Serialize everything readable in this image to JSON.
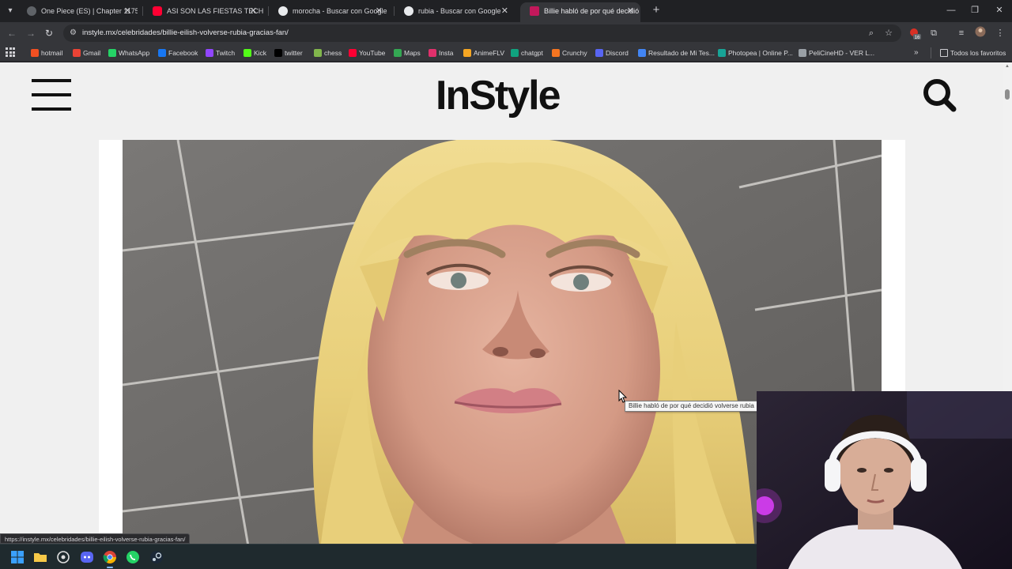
{
  "browser": {
    "tabs": [
      {
        "title": "One Piece (ES) | Chapter 1175",
        "favicon": "onepiece-icon",
        "color": "#9aa0a6",
        "active": false
      },
      {
        "title": "ASI SON LAS FIESTAS TECHNO",
        "favicon": "youtube-icon",
        "color": "#ff0033",
        "active": false
      },
      {
        "title": "morocha - Buscar con Google",
        "favicon": "google-icon",
        "color": "#e8eaed",
        "active": false
      },
      {
        "title": "rubia - Buscar con Google",
        "favicon": "google-icon",
        "color": "#e8eaed",
        "active": false
      },
      {
        "title": "Billie habló de por qué decidió",
        "favicon": "instyle-icon",
        "color": "#c2185b",
        "active": true
      }
    ],
    "new_tab_label": "+",
    "url": "instyle.mx/celebridades/billie-eilish-volverse-rubia-gracias-fan/",
    "bookmarks": [
      {
        "label": "hotmail",
        "icon": "microsoft-icon",
        "color": "#f25022"
      },
      {
        "label": "Gmail",
        "icon": "gmail-icon",
        "color": "#ea4335"
      },
      {
        "label": "WhatsApp",
        "icon": "whatsapp-icon",
        "color": "#25d366"
      },
      {
        "label": "Facebook",
        "icon": "facebook-icon",
        "color": "#1877f2"
      },
      {
        "label": "Twitch",
        "icon": "twitch-icon",
        "color": "#9146ff"
      },
      {
        "label": "Kick",
        "icon": "kick-icon",
        "color": "#53fc18"
      },
      {
        "label": "twitter",
        "icon": "x-icon",
        "color": "#000000"
      },
      {
        "label": "chess",
        "icon": "chess-icon",
        "color": "#81b64c"
      },
      {
        "label": "YouTube",
        "icon": "youtube-icon",
        "color": "#ff0033"
      },
      {
        "label": "Maps",
        "icon": "maps-icon",
        "color": "#34a853"
      },
      {
        "label": "Insta",
        "icon": "instagram-icon",
        "color": "#e1306c"
      },
      {
        "label": "AnimeFLV",
        "icon": "animeflv-icon",
        "color": "#f5a623"
      },
      {
        "label": "chatgpt",
        "icon": "chatgpt-icon",
        "color": "#10a37f"
      },
      {
        "label": "Crunchy",
        "icon": "crunchyroll-icon",
        "color": "#f47521"
      },
      {
        "label": "Discord",
        "icon": "discord-icon",
        "color": "#5865f2"
      },
      {
        "label": "Resultado de Mi Tes...",
        "icon": "globe-icon",
        "color": "#4285f4"
      },
      {
        "label": "Photopea | Online P...",
        "icon": "photopea-icon",
        "color": "#18a497"
      },
      {
        "label": "PeliCineHD - VER L...",
        "icon": "film-icon",
        "color": "#9aa0a6"
      }
    ],
    "all_bookmarks_label": "Todos los favoritos",
    "extension_badge": "16"
  },
  "page": {
    "logo": "InStyle",
    "hero_alt": "Billie Eilish con cabello rubio",
    "tooltip": "Billie habló de por qué decidió volverse rubia",
    "status_url": "https://instyle.mx/celebridades/billie-eilish-volverse-rubia-gracias-fan/"
  },
  "webcam": {
    "overlay": "streamer-webcam"
  },
  "taskbar": {
    "apps": [
      "windows-start-icon",
      "file-explorer-icon",
      "app-icon",
      "discord-icon",
      "chrome-icon",
      "whatsapp-icon",
      "steam-icon"
    ]
  },
  "colors": {
    "accent": "#c2185b",
    "page_bg": "#f0f0f0",
    "chrome_dark": "#202124"
  }
}
